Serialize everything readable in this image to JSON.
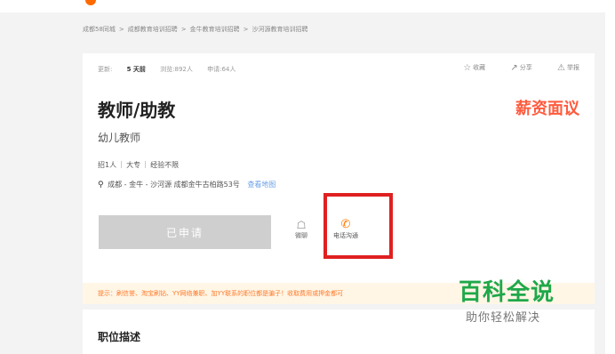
{
  "breadcrumb": [
    "成都58同城",
    "成都教育培训招聘",
    "金牛教育培训招聘",
    "沙河源教育培训招聘"
  ],
  "breadcrumb_separator": ">",
  "meta": {
    "updated_label": "更新:",
    "updated_value": "5 天前",
    "views": "浏览:892人",
    "applications": "申请:64人"
  },
  "actions": {
    "favorite": "收藏",
    "share": "分享",
    "report": "举报"
  },
  "job": {
    "title": "教师/助教",
    "salary": "薪资面议",
    "subtitle": "幼儿教师",
    "tags": [
      "招1人",
      "大专",
      "经验不限"
    ],
    "address": "成都 - 金牛 - 沙河源  成都金牛古柏路53号",
    "map_link": "查看地图"
  },
  "buttons": {
    "apply": "已申请",
    "chat": "微聊",
    "phone": "电话沟通"
  },
  "warning": "提示：刷信誉、淘宝刷钻、YY网络兼职、加YY联系的职位都是骗子！收取费用或押金都可",
  "section": {
    "description_title": "职位描述"
  },
  "watermark": {
    "main": "百科全说",
    "sub": "助你轻松解决"
  },
  "colors": {
    "salary": "#ff5a3d",
    "highlight": "#e02020",
    "phone_icon": "#ff7a00",
    "watermark": "#1fa84a"
  },
  "icons": {
    "favorite": "star-outline-icon",
    "share": "share-icon",
    "report": "report-icon",
    "location": "location-pin-icon",
    "chat": "chat-bubble-icon",
    "phone": "phone-icon"
  }
}
